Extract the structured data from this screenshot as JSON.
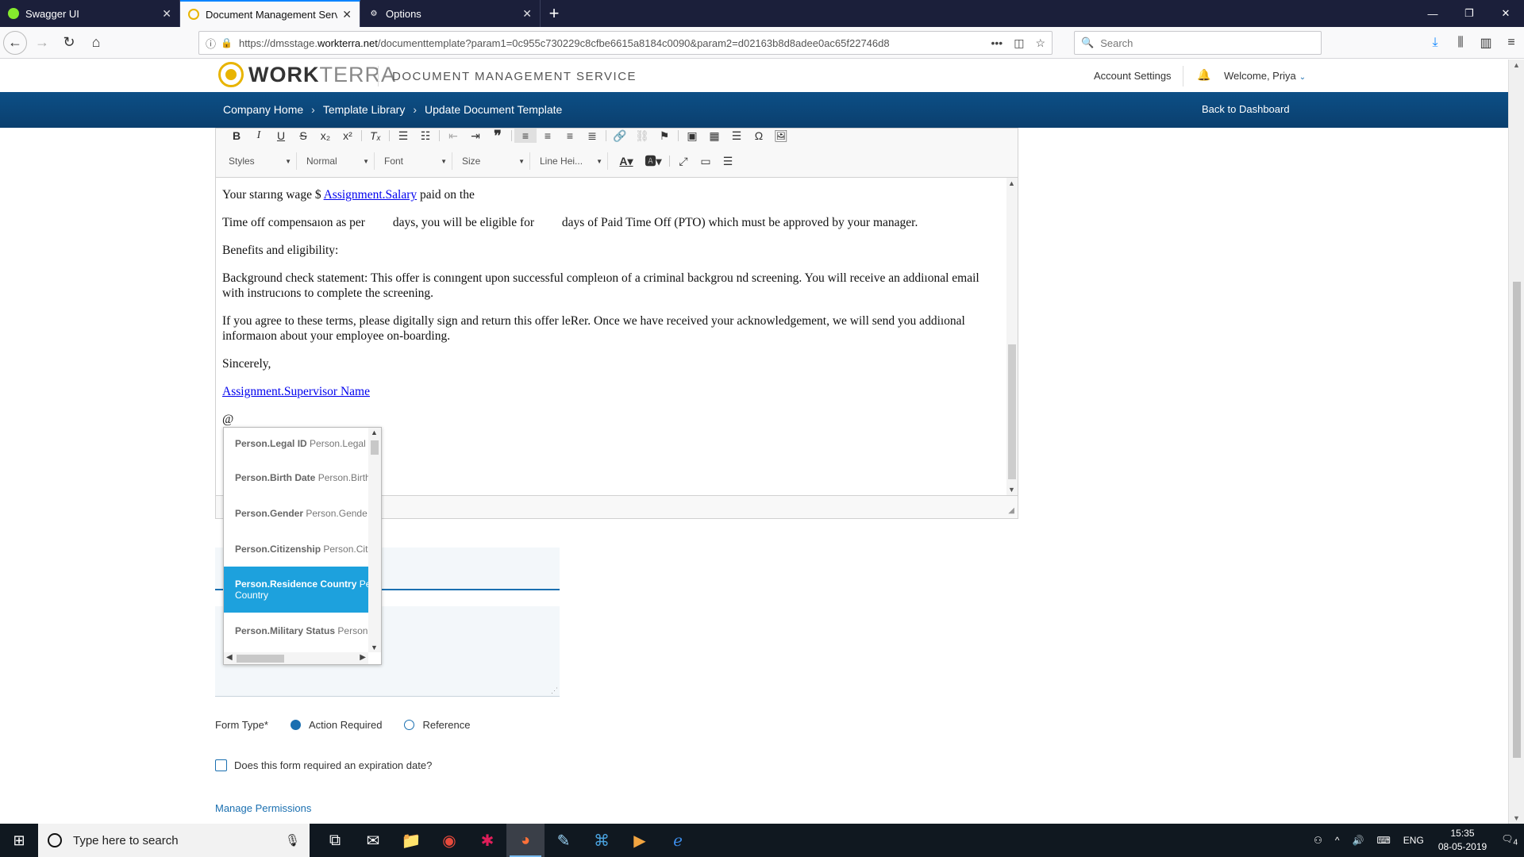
{
  "browser": {
    "tabs": [
      {
        "label": "Swagger UI",
        "active": false
      },
      {
        "label": "Document Management Servic",
        "active": true
      },
      {
        "label": "Options",
        "active": false
      }
    ],
    "url_prefix": "https://dmsstage.",
    "url_domain": "workterra.net",
    "url_rest": "/documenttemplate?param1=0c955c730229c8cfbe6615a8184c0090&param2=d02163b8d8adee0ac65f22746d8",
    "search_placeholder": "Search"
  },
  "header": {
    "logo_bold": "WORK",
    "logo_light": "TERRA",
    "app_title": "DOCUMENT MANAGEMENT SERVICE",
    "account_settings": "Account Settings",
    "welcome": "Welcome, Priya"
  },
  "breadcrumb": {
    "items": [
      "Company Home",
      "Template Library",
      "Update Document Template"
    ],
    "back": "Back to Dashboard"
  },
  "toolbar": {
    "styles": "Styles",
    "format": "Normal",
    "font": "Font",
    "size": "Size",
    "line_height": "Line Hei..."
  },
  "content": {
    "p1_pre": "Your starıng wage $ ",
    "p1_link": "Assignment.Salary",
    "p1_post": " paid on the",
    "p2": "Time off compensaıon as per         days, you will be eligible for         days of Paid Time Off (PTO) which must be approved by your manager.",
    "p3": "Benefits and eligibility:",
    "p4": "Background check statement: This offer is conıngent upon successful compleıon of a criminal backgrou nd screening. You will receive an addiıonal email with instrucıons to complete the screening.",
    "p5": "If you agree to these terms, please digitally sign and return this offer leRer. Once we have received your acknowledgement, we will send you addiıonal informaıon about your employee on-boarding.",
    "p6": "Sincerely,",
    "p7_link": "Assignment.Supervisor Name",
    "p8": "@"
  },
  "autocomplete": {
    "items": [
      {
        "key": "Person.Legal ID",
        "value": "Person.Legal",
        "selected": false
      },
      {
        "key": "Person.Birth Date",
        "value": "Person.Birth",
        "selected": false
      },
      {
        "key": "Person.Gender",
        "value": "Person.Gende",
        "selected": false
      },
      {
        "key": "Person.Citizenship",
        "value": "Person.Cit",
        "selected": false
      },
      {
        "key": "Person.Residence Country",
        "value": "Pe",
        "value2": "Country",
        "selected": true
      },
      {
        "key": "Person.Military Status",
        "value": "Person",
        "selected": false
      }
    ]
  },
  "form": {
    "form_type_label": "Form Type*",
    "opt_action": "Action Required",
    "opt_reference": "Reference",
    "form_type_selected": "Action Required",
    "expire_label": "Does this form required an expiration date?",
    "manage_permissions": "Manage Permissions"
  },
  "taskbar": {
    "search_placeholder": "Type here to search",
    "lang": "ENG",
    "time": "15:35",
    "date": "08-05-2019",
    "notif_count": "4"
  },
  "colors": {
    "brand_blue": "#0d4f86",
    "accent": "#1a6fb0",
    "selected_item": "#1da1dd",
    "logo_gold": "#e8b400"
  }
}
